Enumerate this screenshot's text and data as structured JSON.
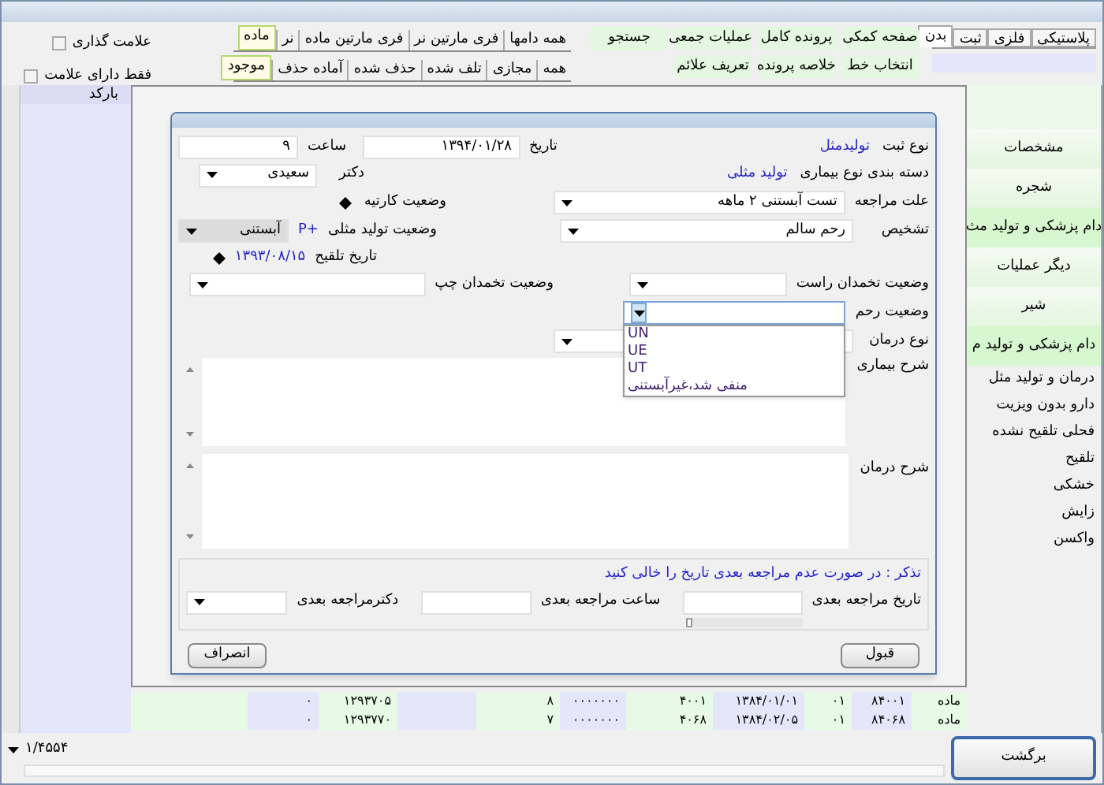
{
  "type_tabs": [
    {
      "label": "پلاستیکی",
      "selected": false
    },
    {
      "label": "فلزی",
      "selected": false
    },
    {
      "label": "ثبت",
      "selected": false
    },
    {
      "label": "بدن",
      "selected": true
    }
  ],
  "toolbar_rows": [
    {
      "buttons": [
        "صفحه کمکی",
        "پرونده کامل",
        "عملیات جمعی",
        "جستجو"
      ]
    },
    {
      "buttons": [
        "انتخاب خط",
        "خلاصه پرونده",
        "تعریف علائم"
      ]
    }
  ],
  "sex_tabs": [
    {
      "label": "همه دامها",
      "selected": false
    },
    {
      "label": "فری مارتین نر",
      "selected": false
    },
    {
      "label": "فری مارتین ماده",
      "selected": false
    },
    {
      "label": "نر",
      "selected": false
    },
    {
      "label": "ماده",
      "selected": true
    }
  ],
  "status_tabs": [
    {
      "label": "همه",
      "selected": false
    },
    {
      "label": "مجازی",
      "selected": false
    },
    {
      "label": "تلف شده",
      "selected": false
    },
    {
      "label": "حذف شده",
      "selected": false
    },
    {
      "label": "آماده حذف",
      "selected": false
    },
    {
      "label": "موجود",
      "selected": true
    }
  ],
  "checkboxes": [
    {
      "label": "علامت گذاری",
      "checked": false
    },
    {
      "label": "فقط دارای علامت",
      "checked": false
    }
  ],
  "left_column": {
    "header": "بارکد"
  },
  "sidebar": {
    "items": [
      {
        "label": "مشخصات",
        "kind": "section"
      },
      {
        "label": "شجره",
        "kind": "section"
      },
      {
        "label": "دام پزشکی و تولید مث",
        "kind": "active"
      },
      {
        "label": "دیگر عملیات",
        "kind": "section"
      },
      {
        "label": "شیر",
        "kind": "section"
      },
      {
        "label": "دام پزشکی و تولید م",
        "kind": "active"
      },
      {
        "label": "درمان و تولید مثل",
        "kind": "link"
      },
      {
        "label": "دارو بدون ویزیت",
        "kind": "link"
      },
      {
        "label": "فحلی تلقیح نشده",
        "kind": "link"
      },
      {
        "label": "تلقیح",
        "kind": "link"
      },
      {
        "label": "خشکی",
        "kind": "link"
      },
      {
        "label": "زایش",
        "kind": "link"
      },
      {
        "label": "واکسن",
        "kind": "link"
      }
    ]
  },
  "table": {
    "rows": [
      {
        "cells": [
          "ماده",
          "۸۴۰۰۱",
          "۰۱",
          "۱۳۸۴/۰۱/۰۱",
          "۴۰۰۱",
          "۰۰۰۰۰۰۰",
          "۸",
          "۱۲۹۳۷۰۵",
          "۰"
        ]
      },
      {
        "cells": [
          "ماده",
          "۸۴۰۶۸",
          "۰۱",
          "۱۳۸۴/۰۲/۰۵",
          "۴۰۶۸",
          "۰۰۰۰۰۰۰",
          "۷",
          "۱۲۹۳۷۷۰",
          "۰"
        ]
      }
    ]
  },
  "pager": "۱/۴۵۵۴",
  "back_button": "برگشت",
  "dialog": {
    "record_type": {
      "label": "نوع ثبت",
      "value": "تولیدمثل"
    },
    "disease_category": {
      "label": "دسته بندی نوع بیماری",
      "value": "تولید مثلی"
    },
    "date": {
      "label": "تاریخ",
      "value": "۱۳۹۴/۰۱/۲۸"
    },
    "time": {
      "label": "ساعت",
      "value": "۹"
    },
    "doctor": {
      "label": "دکتر",
      "value": "سعیدی"
    },
    "visit_reason": {
      "label": "علت مراجعه",
      "value": "تست آبستنی ۲ ماهه"
    },
    "carnet_status": {
      "label": "وضعیت کارتیه"
    },
    "diagnosis": {
      "label": "تشخیص",
      "value": "رحم سالم"
    },
    "repro_status": {
      "label": "وضعیت تولید مثلی",
      "badge": "P+",
      "value": "آبستنی",
      "disabled": true
    },
    "insemination_date": {
      "label": "تاریخ تلقیح",
      "value": "۱۳۹۳/۰۸/۱۵"
    },
    "right_ovary": {
      "label": "وضعیت تخمدان راست"
    },
    "left_ovary": {
      "label": "وضعیت تخمدان چپ"
    },
    "uterus_status": {
      "label": "وضعیت رحم",
      "expanded": true,
      "options": [
        "UN",
        "UE",
        "UT",
        "منفی شد،غیرآبستنی"
      ]
    },
    "treatment_type": {
      "label": "نوع درمان"
    },
    "disease_description": {
      "label": "شرح بیماری"
    },
    "treatment_description": {
      "label": "شرح درمان"
    },
    "note": "تذکر : در صورت عدم مراجعه بعدی تاریخ را خالی کنید",
    "next_visit_date": {
      "label": "تاریخ مراجعه بعدی"
    },
    "next_visit_time": {
      "label": "ساعت مراجعه بعدی"
    },
    "next_visit_doctor": {
      "label": "دکترمراجعه بعدی"
    },
    "buttons": [
      "قبول",
      "انصراف"
    ]
  }
}
